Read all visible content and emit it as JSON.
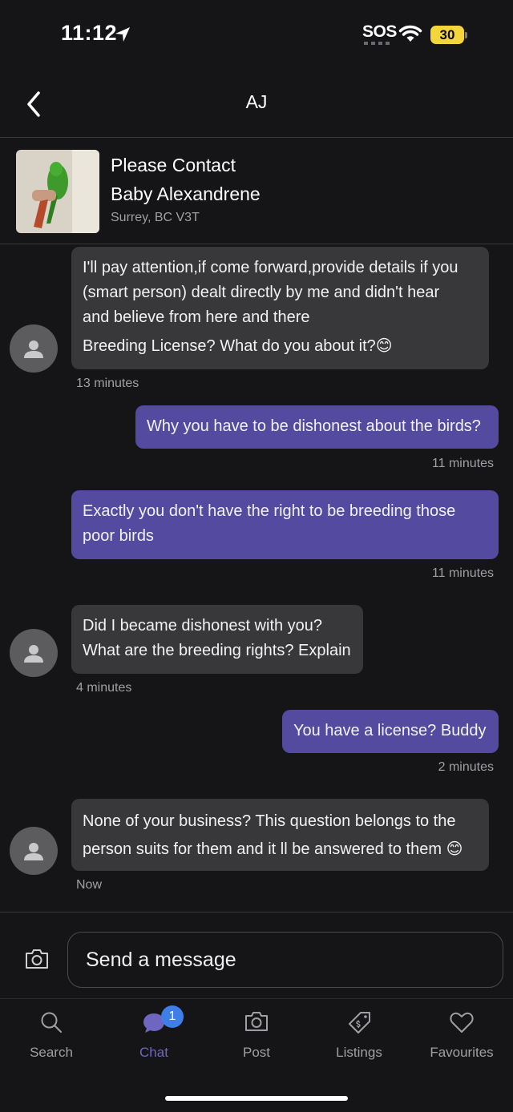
{
  "status_bar": {
    "time": "11:12",
    "sos": "SOS",
    "battery": "30"
  },
  "header": {
    "title": "AJ",
    "back_icon": "chevron-left-icon"
  },
  "listing": {
    "title_line1": "Please Contact",
    "title_line2": "Baby Alexandrene",
    "location": "Surrey, BC V3T"
  },
  "messages": [
    {
      "direction": "incoming",
      "lines": [
        "I'll pay attention,if come forward,provide details if you",
        "(smart person) dealt directly by me and didn't hear",
        "and believe from here and there",
        "Breeding License?   What do you about it?😊"
      ],
      "time": "13 minutes"
    },
    {
      "direction": "outgoing",
      "lines": [
        "Why you have to be dishonest about the birds?"
      ],
      "time": "11 minutes"
    },
    {
      "direction": "outgoing",
      "lines": [
        "Exactly you don't have the right to be breeding those",
        "poor birds"
      ],
      "time": "11 minutes"
    },
    {
      "direction": "incoming",
      "lines": [
        "Did I became dishonest with you?",
        "What are the breeding rights? Explain"
      ],
      "time": "4 minutes"
    },
    {
      "direction": "outgoing",
      "lines": [
        "You have a license?  Buddy"
      ],
      "time": "2 minutes"
    },
    {
      "direction": "incoming",
      "lines": [
        "None of your business? This question belongs to the",
        "person suits for them and it ll be answered to them 😊"
      ],
      "time": "Now"
    }
  ],
  "composer": {
    "placeholder": "Send a message",
    "camera_icon": "camera-icon"
  },
  "tabs": [
    {
      "label": "Search",
      "icon": "search-icon"
    },
    {
      "label": "Chat",
      "icon": "chat-icon",
      "badge": "1",
      "active": true
    },
    {
      "label": "Post",
      "icon": "camera-icon"
    },
    {
      "label": "Listings",
      "icon": "price-tag-icon"
    },
    {
      "label": "Favourites",
      "icon": "heart-icon"
    }
  ],
  "colors": {
    "background": "#151517",
    "incoming_bubble": "#38383a",
    "outgoing_bubble": "#544ba1",
    "active_tab": "#6f66c2",
    "badge": "#3f7ee8",
    "battery": "#f4d63a"
  }
}
